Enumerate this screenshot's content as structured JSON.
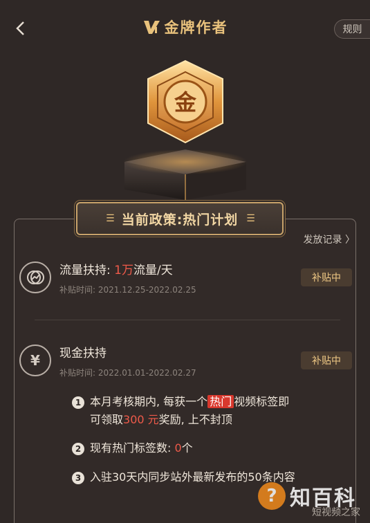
{
  "header": {
    "title": "金牌作者",
    "rules_label": "规则"
  },
  "policy": {
    "title": "当前政策:热门计划",
    "record_link": "发放记录 〉"
  },
  "traffic": {
    "title_prefix": "流量扶持: ",
    "title_highlight": "1万",
    "title_suffix": "流量/天",
    "period": "补贴时间:  2021.12.25-2022.02.25",
    "badge": "补贴中"
  },
  "cash": {
    "title": "现金扶持",
    "period": "补贴时间:  2022.01.01-2022.02.27",
    "badge": "补贴中"
  },
  "rules": [
    {
      "num": "1",
      "part1": "本月考核期内, 每获一个",
      "hot": "热门",
      "part2": "视频标签即",
      "line2_a": "可领取",
      "amount": "300 元",
      "line2_b": "奖励, 上不封顶"
    },
    {
      "num": "2",
      "text_a": "现有热门标签数: ",
      "count": "0",
      "text_b": "个"
    },
    {
      "num": "3",
      "text": "入驻30天内同步站外最新发布的50条内容"
    }
  ],
  "watermark": {
    "icon": "?",
    "brand": "知百科",
    "sub": "短视频之家"
  },
  "colors": {
    "background": "#2f2826",
    "gold": "#e9c27c",
    "red": "#ef5a4a",
    "badge_text": "#f0c985"
  }
}
